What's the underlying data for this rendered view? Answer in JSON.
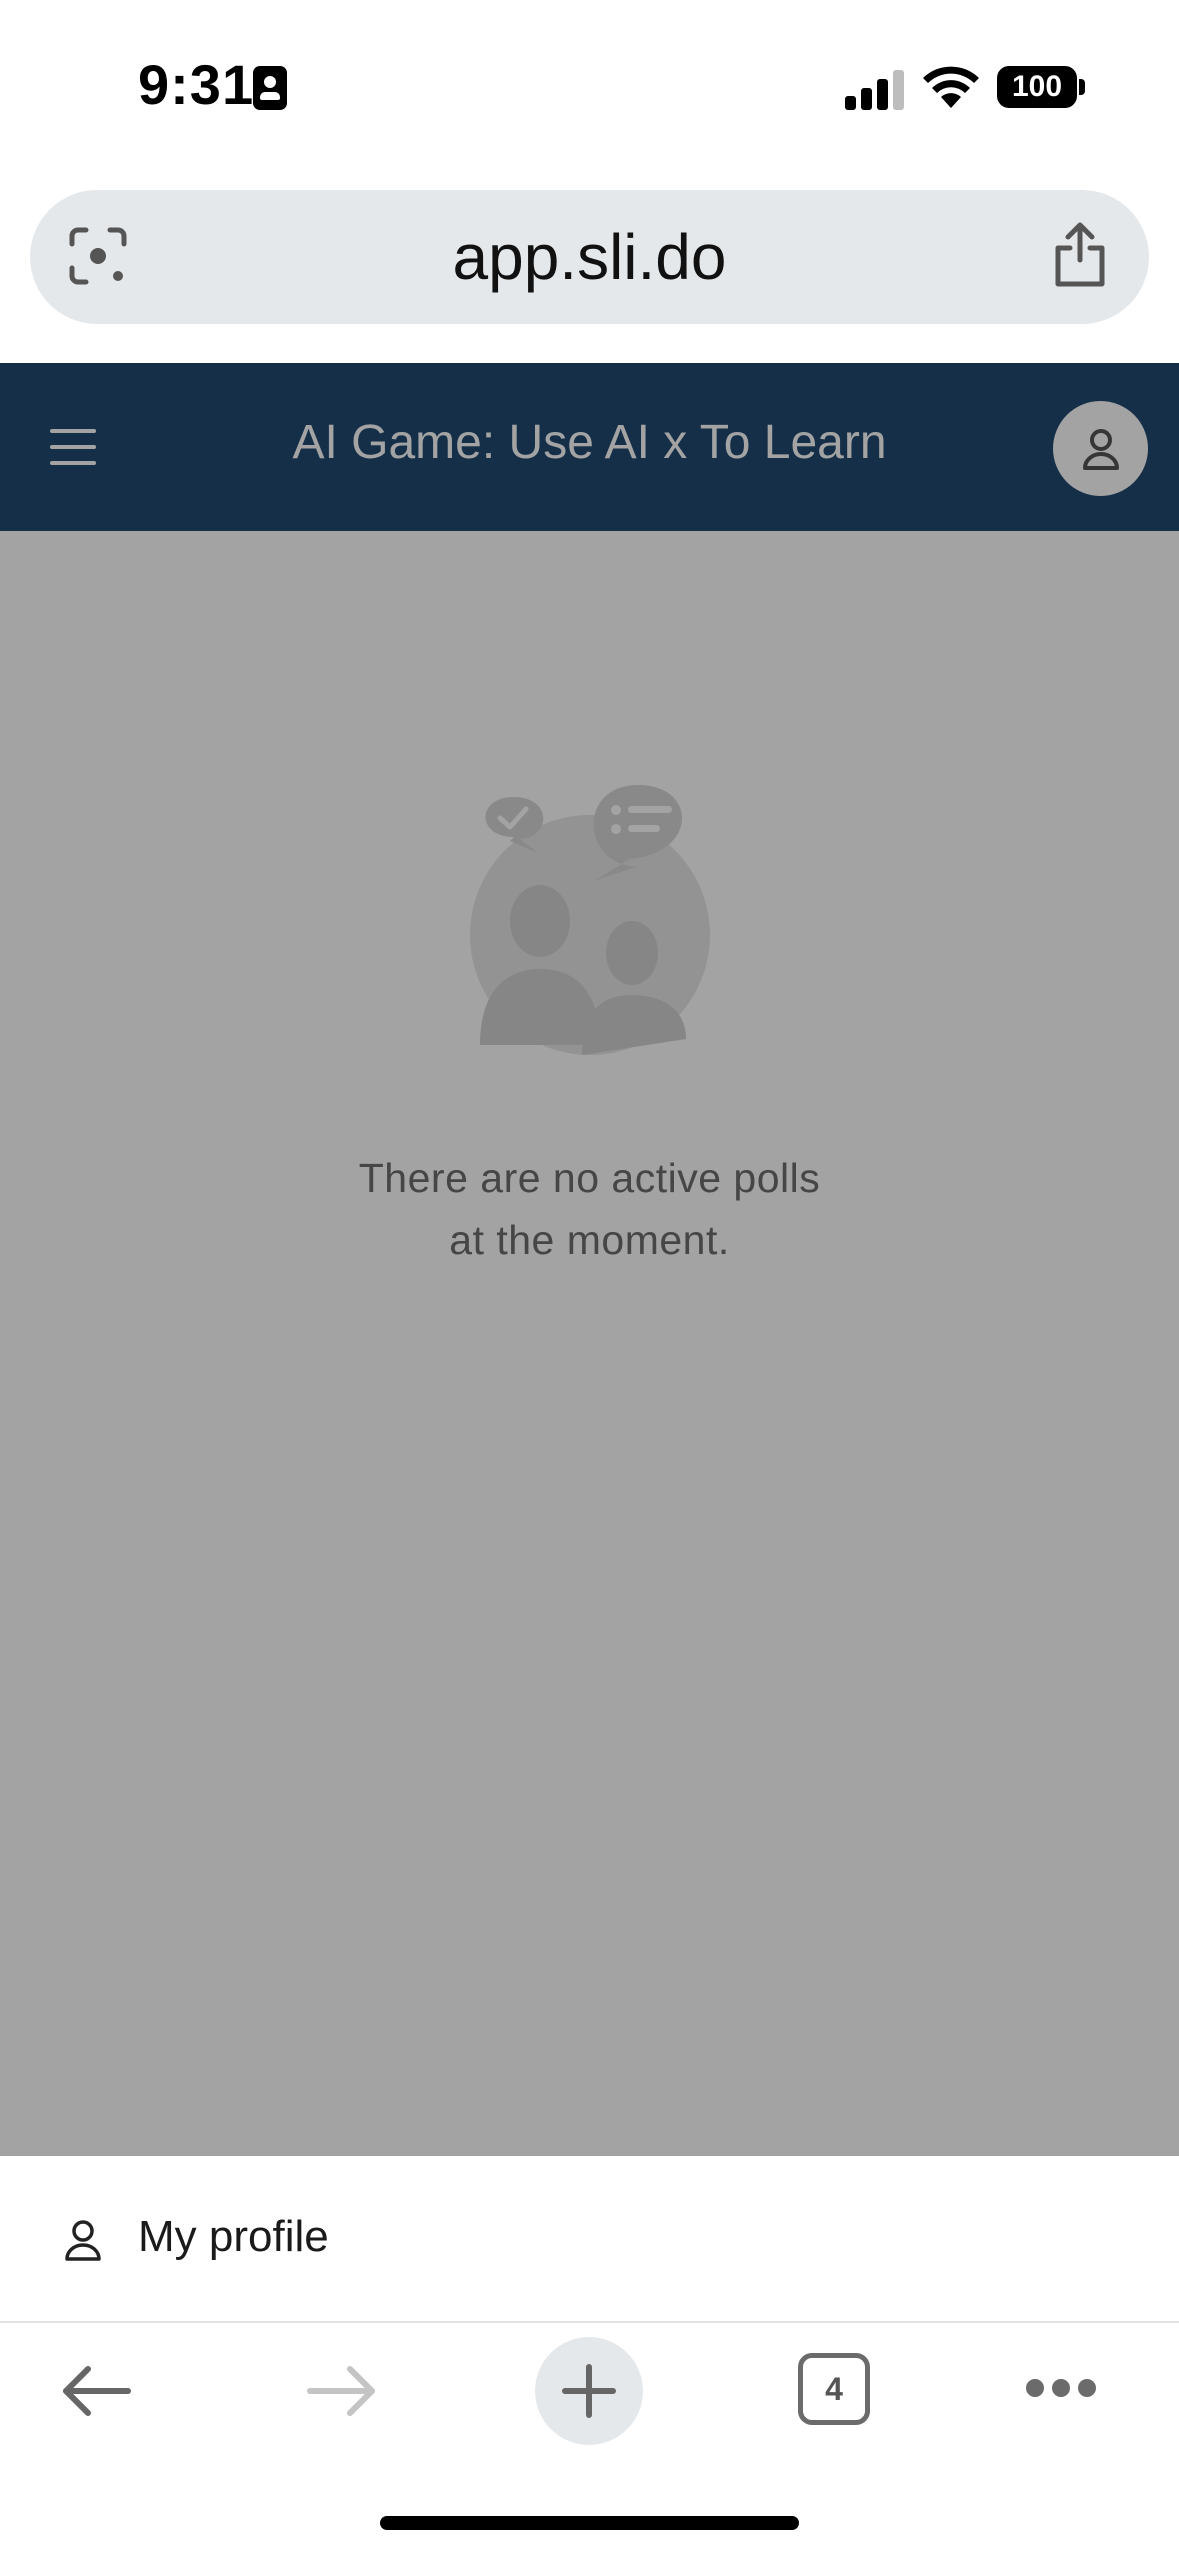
{
  "status_bar": {
    "time": "9:31",
    "battery": "100",
    "icons": [
      "id-card-icon",
      "cellular-signal-icon",
      "wifi-icon",
      "battery-icon"
    ]
  },
  "browser": {
    "url": "app.sli.do",
    "tab_count": "4",
    "icons": [
      "lens-icon",
      "share-icon",
      "back-arrow-icon",
      "forward-arrow-icon",
      "plus-icon",
      "tabs-icon",
      "more-icon"
    ]
  },
  "app": {
    "title": "AI Game: Use AI x To Learn",
    "header_color": "#214a72",
    "empty_state": {
      "line1": "There are no active polls",
      "line2": "at the moment."
    }
  },
  "menu": {
    "items": [
      {
        "label": "My profile",
        "icon": "person-icon"
      }
    ]
  }
}
